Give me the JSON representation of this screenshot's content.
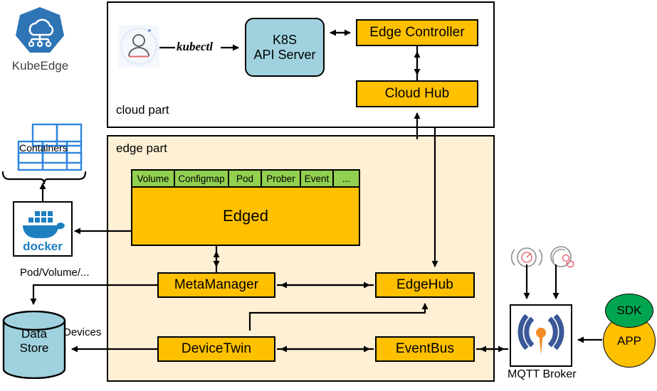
{
  "brand": {
    "name": "KubeEdge",
    "logo_icon": "kubeedge-cloud-logo",
    "logo_color": "#2E75B6"
  },
  "cloud_part": {
    "label": "cloud part",
    "user_icon": "user-avatar-icon",
    "command_label": "kubectl",
    "api_server": {
      "line1": "K8S",
      "line2": "API Server",
      "color": "#9FD2DE"
    },
    "edge_controller": {
      "label": "Edge Controller",
      "color": "#FFC000"
    },
    "cloud_hub": {
      "label": "Cloud Hub",
      "color": "#FFC000"
    }
  },
  "edge_part": {
    "label": "edge part",
    "edged": {
      "label": "Edged",
      "color": "#FFC000",
      "tabs": [
        "Volume",
        "Configmap",
        "Pod",
        "Prober",
        "Event",
        "..."
      ],
      "tab_color": "#92D050"
    },
    "meta_manager": {
      "label": "MetaManager",
      "color": "#FFC000"
    },
    "edge_hub": {
      "label": "EdgeHub",
      "color": "#FFC000"
    },
    "device_twin": {
      "label": "DeviceTwin",
      "color": "#FFC000"
    },
    "event_bus": {
      "label": "EventBus",
      "color": "#FFC000"
    }
  },
  "left_column": {
    "containers": {
      "label": "Containers",
      "icon": "containers-grid-icon",
      "color": "#2E86DE"
    },
    "docker": {
      "label": "docker",
      "icon": "docker-whale-icon",
      "color": "#1D7FC0"
    },
    "data_store": {
      "line1": "Data",
      "line2": "Store",
      "icon": "database-cylinder-icon",
      "color": "#9FD2DE"
    }
  },
  "edges": {
    "pod_volume": "Pod/Volume/...",
    "devices": "Devices"
  },
  "right_column": {
    "mqtt_broker": {
      "label": "MQTT Broker",
      "icon": "mqtt-antenna-icon",
      "color": "#3B5998",
      "accent": "#F28C28"
    },
    "sensors": [
      {
        "icon": "sensor-radar-icon",
        "color": "#E8737D"
      },
      {
        "icon": "sensor-gear-icon",
        "color": "#E8737D"
      }
    ],
    "sdk": {
      "label": "SDK",
      "color": "#00A550"
    },
    "app": {
      "label": "APP",
      "color": "#FFC000"
    }
  }
}
